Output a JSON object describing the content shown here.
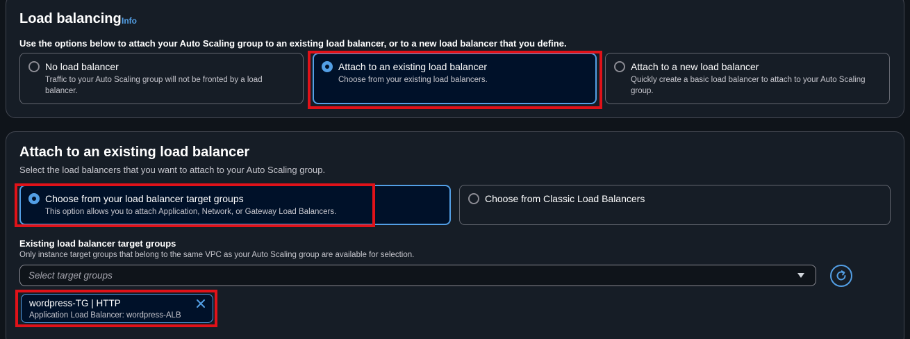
{
  "load_balancing": {
    "title": "Load balancing",
    "info_link": "Info",
    "description": "Use the options below to attach your Auto Scaling group to an existing load balancer, or to a new load balancer that you define.",
    "options": [
      {
        "label": "No load balancer",
        "description": "Traffic to your Auto Scaling group will not be fronted by a load balancer.",
        "selected": false
      },
      {
        "label": "Attach to an existing load balancer",
        "description": "Choose from your existing load balancers.",
        "selected": true
      },
      {
        "label": "Attach to a new load balancer",
        "description": "Quickly create a basic load balancer to attach to your Auto Scaling group.",
        "selected": false
      }
    ]
  },
  "attach_existing": {
    "title": "Attach to an existing load balancer",
    "description": "Select the load balancers that you want to attach to your Auto Scaling group.",
    "options": [
      {
        "label": "Choose from your load balancer target groups",
        "description": "This option allows you to attach Application, Network, or Gateway Load Balancers.",
        "selected": true
      },
      {
        "label": "Choose from Classic Load Balancers",
        "description": "",
        "selected": false
      }
    ],
    "target_groups_field": {
      "label": "Existing load balancer target groups",
      "description": "Only instance target groups that belong to the same VPC as your Auto Scaling group are available for selection.",
      "placeholder": "Select target groups",
      "selected_tokens": [
        {
          "title": "wordpress-TG | HTTP",
          "subtitle": "Application Load Balancer: wordpress-ALB"
        }
      ]
    }
  },
  "icons": {
    "refresh": "refresh-icon",
    "dropdown": "caret-down-icon",
    "remove": "close-icon"
  },
  "colors": {
    "accent": "#539fe5",
    "highlight": "#e01219",
    "background": "#0f141a",
    "panel": "#161d26",
    "selected_tile": "#001129"
  }
}
